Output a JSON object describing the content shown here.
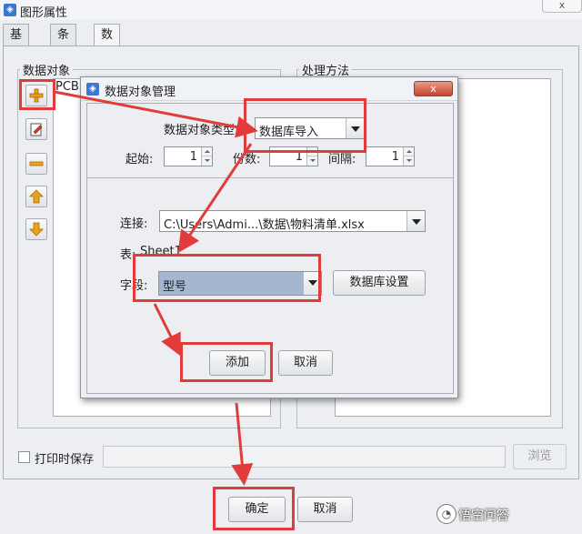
{
  "window": {
    "title": "图形属性",
    "close_glyph": "x"
  },
  "tabs": [
    {
      "label": "基本"
    },
    {
      "label": "条码"
    },
    {
      "label": "数据源"
    }
  ],
  "data_object": {
    "legend": "数据对象",
    "list_item_fragment": "PCB"
  },
  "process": {
    "legend": "处理方法"
  },
  "print_save": {
    "label": "打印时保存",
    "checked": false
  },
  "browse_label": "浏览",
  "footer": {
    "ok_label": "确定",
    "cancel_label": "取消"
  },
  "dialog": {
    "title": "数据对象管理",
    "close_glyph": "x",
    "type_label": "数据对象类型:",
    "type_value": "数据库导入",
    "start_label": "起始:",
    "start_value": "1",
    "copies_label": "份数:",
    "copies_value": "1",
    "interval_label": "间隔:",
    "interval_value": "1",
    "connection_label": "连接:",
    "connection_value": "C:\\Users\\Admi...\\数据\\物料清单.xlsx",
    "table_label": "表:",
    "table_value": "Sheet1",
    "field_label": "字段:",
    "field_value": "型号",
    "db_settings_label": "数据库设置",
    "add_label": "添加",
    "cancel_label": "取消"
  },
  "watermark": {
    "text": "悟空问答",
    "logo_glyph": "◔"
  },
  "colors": {
    "highlight": "#e23b3b",
    "accent": "#3b78d0"
  }
}
